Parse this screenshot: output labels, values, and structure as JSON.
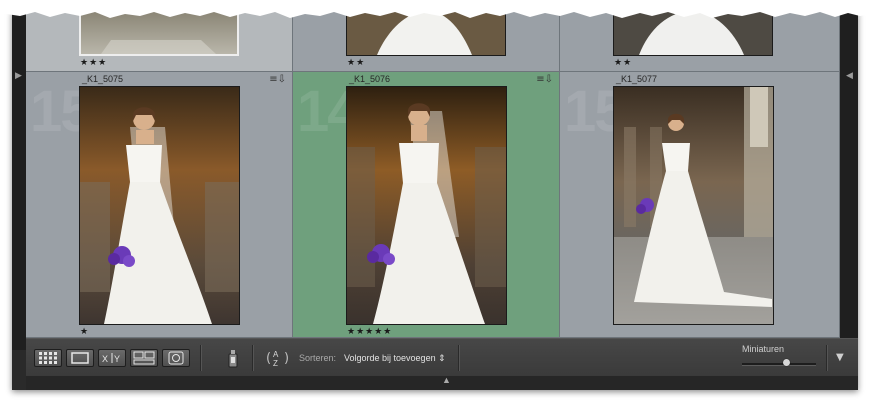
{
  "top_row": {
    "cells": [
      {
        "stars": "★★★"
      },
      {
        "stars": "★★"
      },
      {
        "stars": "★★"
      }
    ]
  },
  "photos": [
    {
      "index": "15",
      "filename": "_K1_5075",
      "stars": "★",
      "selected": false,
      "badge": "≡⇩"
    },
    {
      "index": "14",
      "filename": "_K1_5076",
      "stars": "★★★★★",
      "selected": true,
      "badge": "≡⇩"
    },
    {
      "index": "15",
      "filename": "_K1_5077",
      "stars": "",
      "selected": false,
      "badge": ""
    }
  ],
  "toolbar": {
    "view_buttons": [
      "grid-view",
      "loupe-view",
      "compare-view",
      "survey-view",
      "people-view"
    ],
    "compare_label": "X|Y",
    "spray_icon": "spraycan-icon",
    "sort_icon_label": "A Z",
    "sort_label": "Sorteren:",
    "sort_value": "Volgorde bij toevoegen ⇕",
    "thumbnails_label": "Miniaturen",
    "thumbnail_size": 0.6
  },
  "colors": {
    "selected": "#6fa07d",
    "cell": "#9aa0a6",
    "toolbar": "#3f3f3f"
  }
}
